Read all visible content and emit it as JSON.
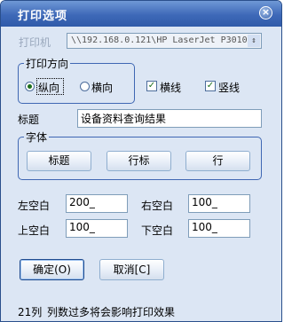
{
  "window": {
    "title": "打印选项",
    "close_glyph": "×"
  },
  "printer": {
    "label": "打印机",
    "value": "\\\\192.168.0.121\\HP LaserJet P3010",
    "arrow": "⇕"
  },
  "orientation": {
    "title": "打印方向",
    "portrait": "纵向",
    "landscape": "横向"
  },
  "options": {
    "hline": "横线",
    "vline": "竖线",
    "check_glyph": "✓"
  },
  "title_field": {
    "label": "标题",
    "value": "设备资料查询结果"
  },
  "font_group": {
    "title": "字体",
    "buttons": [
      "标题",
      "行标",
      "行"
    ]
  },
  "margins": {
    "left": {
      "label": "左空白",
      "value": "200_"
    },
    "right": {
      "label": "右空白",
      "value": "100_"
    },
    "top": {
      "label": "上空白",
      "value": "100_"
    },
    "bottom": {
      "label": "下空白",
      "value": "100_"
    }
  },
  "buttons": {
    "ok": "确定(O)",
    "cancel": "取消[C]"
  },
  "status": {
    "columns": "21列",
    "message": "列数过多将会影响打印效果"
  }
}
